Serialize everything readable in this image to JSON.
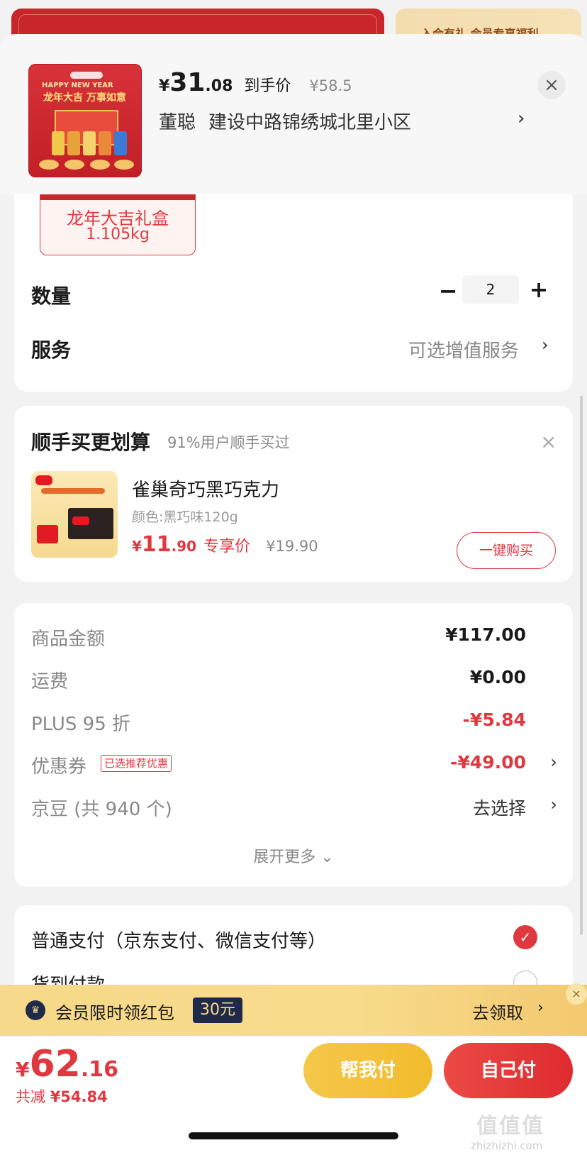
{
  "background": {
    "banner_right_text": "入会有礼 会员专享福利"
  },
  "header": {
    "price_yen": "¥",
    "price_int": "31",
    "price_dec": ".08",
    "price_tag": "到手价",
    "price_original": "¥58.5",
    "recipient": "董聪",
    "address": "建设中路锦绣城北里小区",
    "address_chevron": "›",
    "close": "×",
    "product_thumb_text1": "HAPPY NEW YEAR",
    "product_thumb_text2": "龙年大吉 万事如意"
  },
  "variant": {
    "name": "龙年大吉礼盒",
    "weight": "1.105kg"
  },
  "quantity": {
    "label": "数量",
    "minus": "−",
    "value": "2",
    "plus": "+"
  },
  "service": {
    "label": "服务",
    "value": "可选增值服务",
    "chevron": "›"
  },
  "upsell": {
    "title": "顺手买更划算",
    "subtitle": "91%用户顺手买过",
    "close": "×",
    "product_name": "雀巢奇巧黑巧克力",
    "variant": "颜色:黑巧味120g",
    "price_yen": "¥",
    "price_int": "11",
    "price_dec": ".90",
    "price_tag": "专享价",
    "price_original": "¥19.90",
    "buy_button": "一键购买"
  },
  "fees": {
    "goods_label": "商品金额",
    "goods_value": "¥117.00",
    "shipping_label": "运费",
    "shipping_value": "¥0.00",
    "plus_label": "PLUS 95 折",
    "plus_value": "-¥5.84",
    "coupon_label": "优惠券",
    "coupon_tag": "已选推荐优惠",
    "coupon_value": "-¥49.00",
    "coupon_chevron": "›",
    "jingdou_label": "京豆 (共 940 个)",
    "jingdou_value": "去选择",
    "jingdou_chevron": "›",
    "expand": "展开更多 ⌄"
  },
  "payment": {
    "normal": "普通支付（京东支付、微信支付等）",
    "check": "✓",
    "cod": "货到付款"
  },
  "member_bar": {
    "crown": "♛",
    "text": "会员限时领红包",
    "amount": "30元",
    "action": "去领取",
    "chevron": "›",
    "close": "×"
  },
  "bottom": {
    "total_yen": "¥",
    "total_int": "62",
    "total_dec": ".16",
    "discount_prefix": "共减 ",
    "discount_value": "¥54.84",
    "help_pay": "帮我付",
    "self_pay": "自己付",
    "watermark": "值值值",
    "watermark_url": "zhizhizhi.com"
  },
  "colors": {
    "accent_red": "#e0383f",
    "gold": "#f5c84a",
    "navy": "#1f2a4b"
  }
}
